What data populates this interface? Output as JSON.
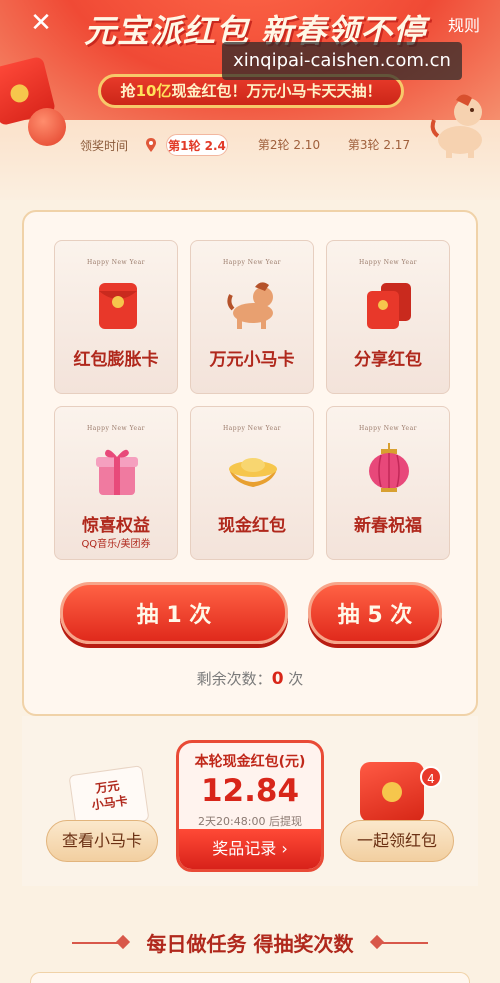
{
  "header": {
    "title": "元宝派红包 新春领不停",
    "rules_label": "规则",
    "watermark": "xinqipai-caishen.com.cn",
    "banner_prefix": "抢",
    "banner_highlight": "10亿",
    "banner_suffix": "现金红包！万元小马卡天天抽！"
  },
  "rounds": {
    "label": "领奖时间",
    "tabs": [
      {
        "label": "第1轮 2.4",
        "active": true
      },
      {
        "label": "第2轮 2.10",
        "active": false
      },
      {
        "label": "第3轮 2.17",
        "active": false
      }
    ]
  },
  "prizes": {
    "happy_new_year": "Happy New Year",
    "tiles": [
      {
        "label": "红包膨胀卡",
        "icon": "red-envelope-icon"
      },
      {
        "label": "万元小马卡",
        "icon": "pony-icon"
      },
      {
        "label": "分享红包",
        "icon": "share-envelope-icon"
      },
      {
        "label": "惊喜权益",
        "sub": "QQ音乐/美团券",
        "icon": "gift-box-icon"
      },
      {
        "label": "现金红包",
        "icon": "gold-ingot-icon"
      },
      {
        "label": "新春祝福",
        "icon": "lantern-icon"
      }
    ]
  },
  "draw": {
    "once_label": "抽 1 次",
    "five_label": "抽 5 次",
    "remaining_prefix": "剩余次数：",
    "remaining_count": "0",
    "remaining_suffix": " 次"
  },
  "cash": {
    "title": "本轮现金红包(元)",
    "amount": "12.84",
    "countdown": "2天20:48:00 后提现",
    "record_label": "奖品记录 ›"
  },
  "side": {
    "pony_card_text": "万元\n小马卡",
    "view_pony_label": "查看小马卡",
    "together_label": "一起领红包",
    "badge_count": "4"
  },
  "tasks": {
    "title": "每日做任务 得抽奖次数"
  },
  "colors": {
    "primary_red": "#e02a1c",
    "gold": "#f7c96a",
    "background": "#fbf1e2"
  }
}
